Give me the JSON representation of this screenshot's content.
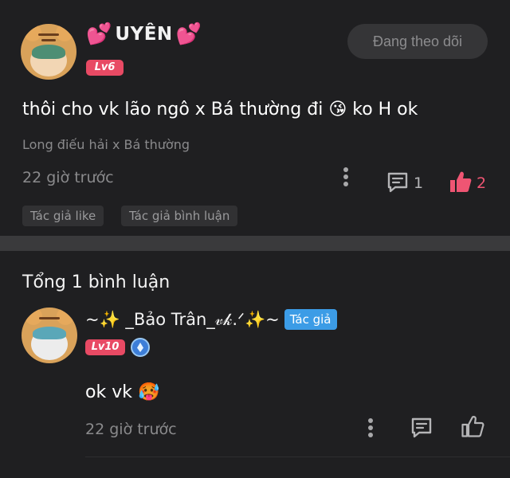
{
  "post": {
    "author": {
      "prefix_emoji": "💕",
      "name": "UYÊN",
      "suffix_emoji": "💕",
      "level": "Lv6"
    },
    "follow_button": "Đang theo dõi",
    "text": "thôi cho vk lão ngô x Bá thường đi 😘 ko H ok",
    "tag": "Long điếu hải x Bá thường",
    "time": "22 giờ trước",
    "comment_count": "1",
    "like_count": "2",
    "chips": [
      "Tác giả like",
      "Tác giả bình luận"
    ]
  },
  "comments": {
    "header": "Tổng 1 bình luận",
    "items": [
      {
        "author": "~✨ _Bảo Trân_𝓋𝓀.ᐟ✨~",
        "author_badge": "Tác giả",
        "level": "Lv10",
        "text": "ok vk 🥵",
        "time": "22 giờ trước"
      }
    ]
  },
  "icons": {
    "more": "more-vertical-icon",
    "comment": "comment-icon",
    "like": "thumbs-up-icon",
    "gem": "gem-badge-icon"
  },
  "colors": {
    "background": "#1f1f21",
    "accent_pink": "#ef5573",
    "level_badge": "#e84a64",
    "author_badge": "#3c9ce6"
  }
}
